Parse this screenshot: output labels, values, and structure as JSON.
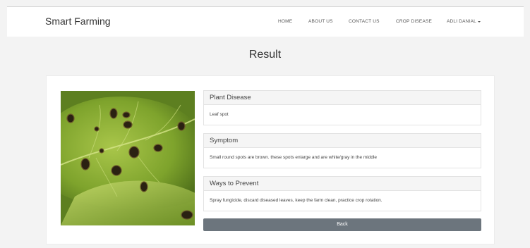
{
  "nav": {
    "brand": "Smart Farming",
    "items": [
      "HOME",
      "ABOUT US",
      "CONTACT US",
      "CROP DISEASE"
    ],
    "user": "ADLI DANIAL"
  },
  "page": {
    "title": "Result"
  },
  "result": {
    "sections": [
      {
        "heading": "Plant Disease",
        "body": "Leaf spot"
      },
      {
        "heading": "Symptom",
        "body": "Small round spots are brown. these spots enlarge and are white/gray in the middle"
      },
      {
        "heading": "Ways to Prevent",
        "body": "Spray fungicide, discard diseased leaves, keep the farm clean, practice crop rotation."
      }
    ],
    "back_label": "Back"
  },
  "colors": {
    "navbar_bg": "#ffffff",
    "page_bg": "#f3f3f3",
    "button_bg": "#6c757d"
  }
}
